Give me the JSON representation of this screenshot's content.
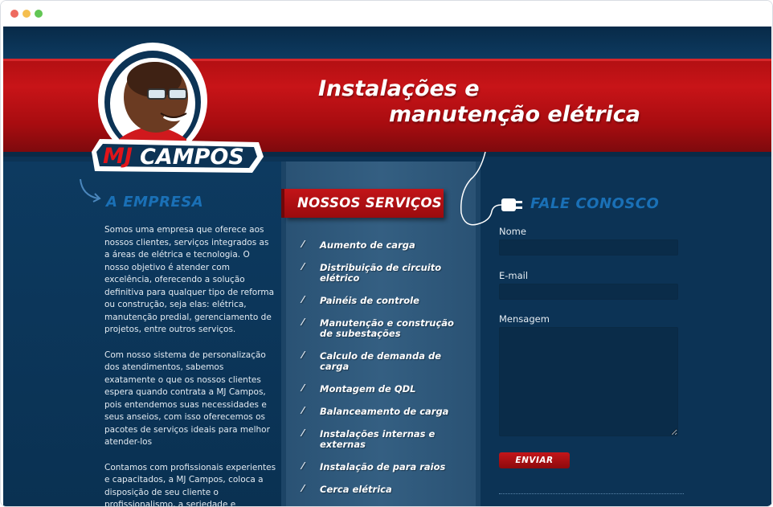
{
  "banner": {
    "headline_line1": "Instalações e",
    "headline_line2": "manutenção elétrica"
  },
  "logo": {
    "text_mj": "MJ",
    "text_campos": "CAMPOS"
  },
  "empresa": {
    "title": "A EMPRESA",
    "paragraphs": [
      "Somos uma empresa que oferece aos nossos clientes, serviços integrados as a áreas de elétrica e tecnologia. O nosso objetivo é atender com excelência, oferecendo a solução definitiva para qualquer tipo de reforma ou construção, seja elas: elétrica, manutenção predial, gerenciamento de projetos, entre outros serviços.",
      "Com nosso sistema de personalização dos atendimentos, sabemos exatamente o que os nossos clientes espera quando contrata a MJ Campos, pois entendemos suas necessidades e seus anseios, com isso oferecemos os pacotes de serviços ideais para melhor atender-los",
      "Contamos com profissionais experientes e capacitados, a MJ Campos, coloca a disposição de seu cliente o profissionalismo, a seriedade e"
    ]
  },
  "servicos": {
    "title": "NOSSOS SERVIÇOS",
    "check_glyph": "⁄",
    "items": [
      "Aumento de carga",
      "Distribuição de circuito elétrico",
      "Painéis de controle",
      "Manutenção e construção de subestações",
      "Calculo de demanda de carga",
      "Montagem de QDL",
      "Balanceamento de carga",
      "Instalações internas e externas",
      "Instalação de para raios",
      "Cerca elétrica"
    ]
  },
  "contato": {
    "title": "FALE CONOSCO",
    "nome_label": "Nome",
    "nome_value": "",
    "email_label": "E-mail",
    "email_value": "",
    "mensagem_label": "Mensagem",
    "mensagem_value": "",
    "send_label": "ENVIAR"
  },
  "colors": {
    "brand_red": "#c21418",
    "brand_blue": "#0c3355",
    "title_blue": "#1a70b6"
  }
}
